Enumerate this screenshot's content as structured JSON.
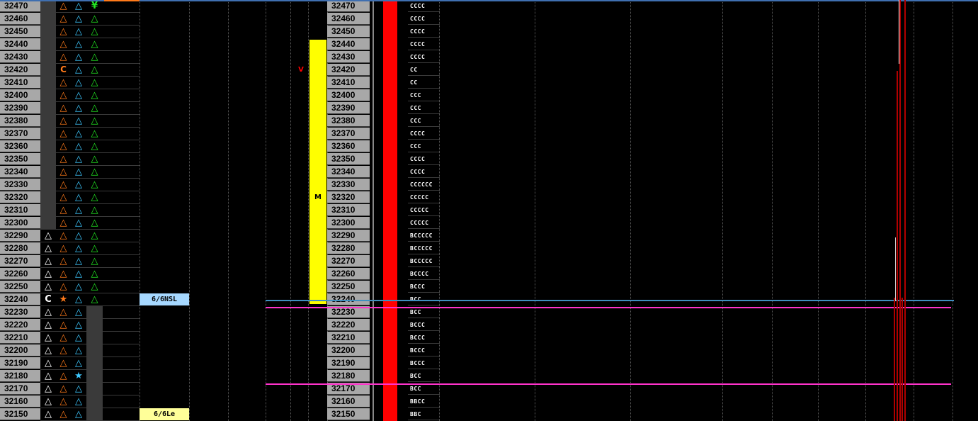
{
  "colors": {
    "price_bg": "#a8a8a8",
    "orange": "#ff7a1a",
    "cyan": "#3ec8ff",
    "green": "#22e622",
    "white": "#ffffff",
    "yellow": "#ffff00",
    "red": "#ff0000",
    "magenta": "#ff33cc",
    "steel": "#3f8fc0",
    "darkred": "#8b0000"
  },
  "rows": [
    {
      "price": "32470",
      "c1": "",
      "c2": "△",
      "c3": "△",
      "c4": "¥",
      "tpo": "CCCC",
      "price2": "32470"
    },
    {
      "price": "32460",
      "c1": "",
      "c2": "△",
      "c3": "△",
      "c4": "△",
      "tpo": "CCCC",
      "price2": "32460"
    },
    {
      "price": "32450",
      "c1": "",
      "c2": "△",
      "c3": "△",
      "c4": "△",
      "tpo": "CCCC",
      "price2": "32450"
    },
    {
      "price": "32440",
      "c1": "",
      "c2": "△",
      "c3": "△",
      "c4": "△",
      "tpo": "CCCC",
      "price2": "32440"
    },
    {
      "price": "32430",
      "c1": "",
      "c2": "△",
      "c3": "△",
      "c4": "△",
      "tpo": "CCCC",
      "price2": "32430"
    },
    {
      "price": "32420",
      "c1": "",
      "c2": "C",
      "c3": "△",
      "c4": "△",
      "tpo": "CC",
      "price2": "32420",
      "mark": "V"
    },
    {
      "price": "32410",
      "c1": "",
      "c2": "△",
      "c3": "△",
      "c4": "△",
      "tpo": "CC",
      "price2": "32410"
    },
    {
      "price": "32400",
      "c1": "",
      "c2": "△",
      "c3": "△",
      "c4": "△",
      "tpo": "CCC",
      "price2": "32400"
    },
    {
      "price": "32390",
      "c1": "",
      "c2": "△",
      "c3": "△",
      "c4": "△",
      "tpo": "CCC",
      "price2": "32390"
    },
    {
      "price": "32380",
      "c1": "",
      "c2": "△",
      "c3": "△",
      "c4": "△",
      "tpo": "CCC",
      "price2": "32380"
    },
    {
      "price": "32370",
      "c1": "",
      "c2": "△",
      "c3": "△",
      "c4": "△",
      "tpo": "CCCC",
      "price2": "32370"
    },
    {
      "price": "32360",
      "c1": "",
      "c2": "△",
      "c3": "△",
      "c4": "△",
      "tpo": "CCC",
      "price2": "32360"
    },
    {
      "price": "32350",
      "c1": "",
      "c2": "△",
      "c3": "△",
      "c4": "△",
      "tpo": "CCCC",
      "price2": "32350"
    },
    {
      "price": "32340",
      "c1": "",
      "c2": "△",
      "c3": "△",
      "c4": "△",
      "tpo": "CCCC",
      "price2": "32340"
    },
    {
      "price": "32330",
      "c1": "",
      "c2": "△",
      "c3": "△",
      "c4": "△",
      "tpo": "CCCCCC",
      "price2": "32330"
    },
    {
      "price": "32320",
      "c1": "",
      "c2": "△",
      "c3": "△",
      "c4": "△",
      "tpo": "CCCCC",
      "price2": "32320",
      "mark": "M"
    },
    {
      "price": "32310",
      "c1": "",
      "c2": "△",
      "c3": "△",
      "c4": "△",
      "tpo": "CCCCC",
      "price2": "32310"
    },
    {
      "price": "32300",
      "c1": "",
      "c2": "△",
      "c3": "△",
      "c4": "△",
      "tpo": "CCCCC",
      "price2": "32300"
    },
    {
      "price": "32290",
      "c1": "△",
      "c2": "△",
      "c3": "△",
      "c4": "△",
      "tpo": "BCCCCC",
      "price2": "32290"
    },
    {
      "price": "32280",
      "c1": "△",
      "c2": "△",
      "c3": "△",
      "c4": "△",
      "tpo": "BCCCCC",
      "price2": "32280"
    },
    {
      "price": "32270",
      "c1": "△",
      "c2": "△",
      "c3": "△",
      "c4": "△",
      "tpo": "BCCCCC",
      "price2": "32270"
    },
    {
      "price": "32260",
      "c1": "△",
      "c2": "△",
      "c3": "△",
      "c4": "△",
      "tpo": "BCCCC",
      "price2": "32260"
    },
    {
      "price": "32250",
      "c1": "△",
      "c2": "△",
      "c3": "△",
      "c4": "△",
      "tpo": "BCCC",
      "price2": "32250"
    },
    {
      "price": "32240",
      "c1": "C",
      "c2": "★",
      "c3": "△",
      "c4": "△",
      "tpo": "BCC",
      "price2": "32240",
      "label": "6/6NSL"
    },
    {
      "price": "32230",
      "c1": "△",
      "c2": "△",
      "c3": "△",
      "c4": "",
      "tpo": "BCC",
      "price2": "32230"
    },
    {
      "price": "32220",
      "c1": "△",
      "c2": "△",
      "c3": "△",
      "c4": "",
      "tpo": "BCCC",
      "price2": "32220"
    },
    {
      "price": "32210",
      "c1": "△",
      "c2": "△",
      "c3": "△",
      "c4": "",
      "tpo": "BCCC",
      "price2": "32210"
    },
    {
      "price": "32200",
      "c1": "△",
      "c2": "△",
      "c3": "△",
      "c4": "",
      "tpo": "BCCC",
      "price2": "32200"
    },
    {
      "price": "32190",
      "c1": "△",
      "c2": "△",
      "c3": "△",
      "c4": "",
      "tpo": "BCCC",
      "price2": "32190"
    },
    {
      "price": "32180",
      "c1": "△",
      "c2": "△",
      "c3": "★",
      "c4": "",
      "tpo": "BCC",
      "price2": "32180"
    },
    {
      "price": "32170",
      "c1": "△",
      "c2": "△",
      "c3": "△",
      "c4": "",
      "tpo": "BCC",
      "price2": "32170"
    },
    {
      "price": "32160",
      "c1": "△",
      "c2": "△",
      "c3": "△",
      "c4": "",
      "tpo": "BBCC",
      "price2": "32160"
    },
    {
      "price": "32150",
      "c1": "△",
      "c2": "△",
      "c3": "△",
      "c4": "",
      "tpo": "BBC",
      "price2": "32150",
      "label": "6/6Le"
    }
  ]
}
